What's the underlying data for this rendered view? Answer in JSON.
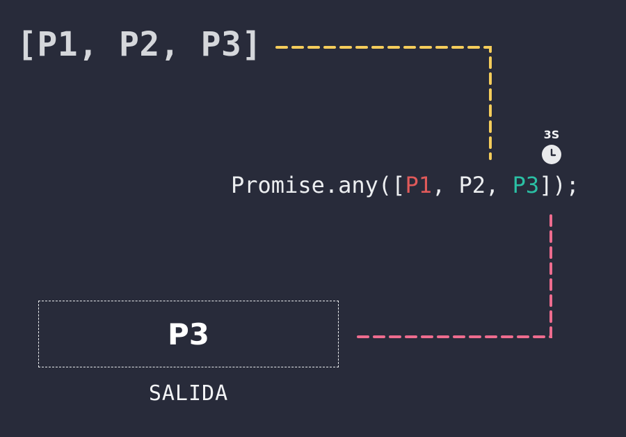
{
  "input": {
    "open": "[",
    "items": [
      "P1",
      "P2",
      "P3"
    ],
    "separator": ", ",
    "close": "]"
  },
  "code": {
    "prefix": "Promise.any([",
    "tokens": [
      {
        "text": "P1",
        "state": "rejected"
      },
      {
        "text": ", ",
        "state": "plain"
      },
      {
        "text": "P2",
        "state": "plain"
      },
      {
        "text": ", ",
        "state": "plain"
      },
      {
        "text": "P3",
        "state": "resolved"
      }
    ],
    "suffix": "]);"
  },
  "timer": {
    "label": "3S",
    "icon": "clock-icon"
  },
  "output": {
    "value": "P3",
    "caption": "SALIDA"
  },
  "colors": {
    "background": "#282b3a",
    "input_connector": "#f5cd5b",
    "output_connector": "#ee6c8e",
    "rejected": "#e05a5a",
    "resolved": "#2bbfa4"
  }
}
